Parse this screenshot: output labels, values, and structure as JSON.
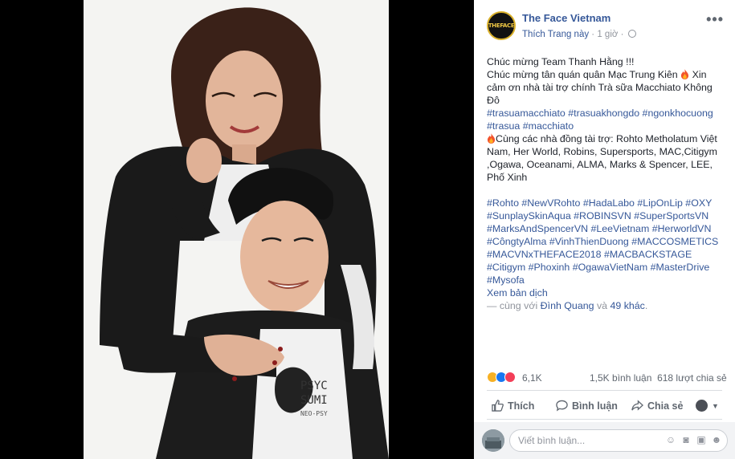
{
  "post": {
    "page_name": "The Face Vietnam",
    "logo_text": "THEFACE",
    "like_page": "Thích Trang này",
    "separator": " · ",
    "time": "1 giờ",
    "privacy_icon": "globe-icon",
    "more_icon": "more-options-icon",
    "text": {
      "line1": "Chúc mừng   Team Thanh Hằng !!!",
      "line2": "Chúc mừng  tân quán quân Mạc Trung Kiên",
      "line2_after": " Xin cảm ơn nhà tài trợ chính Trà sữa Macchiato Không Đô",
      "hashtags1": "#trasuamacchiato #trasuakhongdo #ngonkhocuong #trasua #macchiato",
      "cosponsor": "Cùng các nhà đồng tài trợ: Rohto Metholatum Việt Nam, Her World, Robins, Supersports, MAC,Citigym ,Ogawa, Oceanami, ALMA, Marks & Spencer, LEE, Phố Xinh",
      "hashtags2": "#Rohto #NewVRohto #HadaLabo #LipOnLip #OXY #SunplaySkinAqua #ROBINSVN #SuperSportsVN #MarksAndSpencerVN #LeeVietnam #HerworldVN #CôngtyAlma #VinhThienDuong #MACCOSMETICS #MACVNxTHEFACE2018 #MACBACKSTAGE #Citigym #Phoxinh #OgawaVietNam #MasterDrive #Mysofa",
      "see_translation": "Xem bản dịch",
      "with_prefix": "— cùng với ",
      "with_person": "Đình Quang",
      "with_and": " và ",
      "with_others": "49 khác",
      "with_end": "."
    },
    "stats": {
      "reactions_count": "6,1K",
      "comments": "1,5K bình luận",
      "shares": "618 lượt chia sẻ"
    },
    "actions": {
      "like": "Thích",
      "comment": "Bình luận",
      "share": "Chia sẻ"
    },
    "comment_box": {
      "placeholder": "Viết bình luận..."
    }
  },
  "photo": {
    "printed_text": [
      "PSYC",
      "SUMI",
      "NEO-PSY"
    ]
  },
  "colors": {
    "link": "#365899",
    "text": "#1d2129",
    "muted": "#90949c",
    "background_dark": "#000000"
  }
}
